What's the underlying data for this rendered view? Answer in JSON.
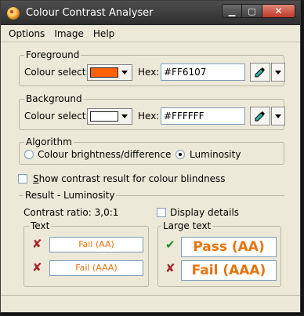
{
  "window": {
    "title": "Colour Contrast Analyser"
  },
  "menu": {
    "items": [
      "Options",
      "Image",
      "Help"
    ]
  },
  "foreground": {
    "group_label": "Foreground",
    "colour_select_label": "Colour select:",
    "swatch_color": "#FF6107",
    "hex_label": "Hex:",
    "hex_value": "#FF6107"
  },
  "background": {
    "group_label": "Background",
    "colour_select_label": "Colour select:",
    "swatch_color": "#FFFFFF",
    "hex_label": "Hex:",
    "hex_value": "#FFFFFF"
  },
  "algorithm": {
    "group_label": "Algorithm",
    "option1": "Colour brightness/difference",
    "option2": "Luminosity",
    "selected": "Luminosity"
  },
  "blindness_checkbox": {
    "label_prefix": "",
    "label_accel": "S",
    "label_rest": "how contrast result for colour blindness",
    "checked": false
  },
  "result": {
    "group_label": "Result - Luminosity",
    "ratio_text": "Contrast ratio: 3,0:1",
    "display_details_label": "Display details",
    "display_details_checked": false,
    "text_group": {
      "label": "Text",
      "aa": "Fail (AA)",
      "aaa": "Fail (AAA)",
      "aa_status": "fail",
      "aaa_status": "fail"
    },
    "large_group": {
      "label": "Large text",
      "aa": "Pass (AA)",
      "aaa": "Fail (AAA)",
      "aa_status": "pass",
      "aaa_status": "fail"
    }
  }
}
